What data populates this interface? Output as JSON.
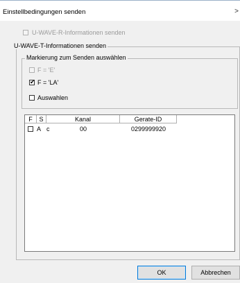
{
  "window": {
    "title": "Einstellbedingungen senden",
    "close_symbol": ">"
  },
  "r_section": {
    "label": "U-WAVE-R-Informationen senden",
    "checked": false,
    "enabled": false
  },
  "t_section": {
    "title": "U-WAVE-T-Informationen senden",
    "marking": {
      "title": "Markierung zum Senden auswählen",
      "options": [
        {
          "label": "F = 'E'",
          "checked": false,
          "enabled": false
        },
        {
          "label": "F = 'LA'",
          "checked": true,
          "enabled": true
        },
        {
          "label": "Auswahlen",
          "checked": false,
          "enabled": true
        }
      ]
    }
  },
  "table": {
    "columns": [
      "F",
      "S",
      "Kanal",
      "Gerate-ID"
    ],
    "rows": [
      {
        "checked": false,
        "f": "A",
        "s": "c",
        "kanal": "00",
        "gerate_id": "0299999920"
      }
    ]
  },
  "buttons": {
    "ok": "OK",
    "cancel": "Abbrechen"
  },
  "check_glyph": "✔"
}
